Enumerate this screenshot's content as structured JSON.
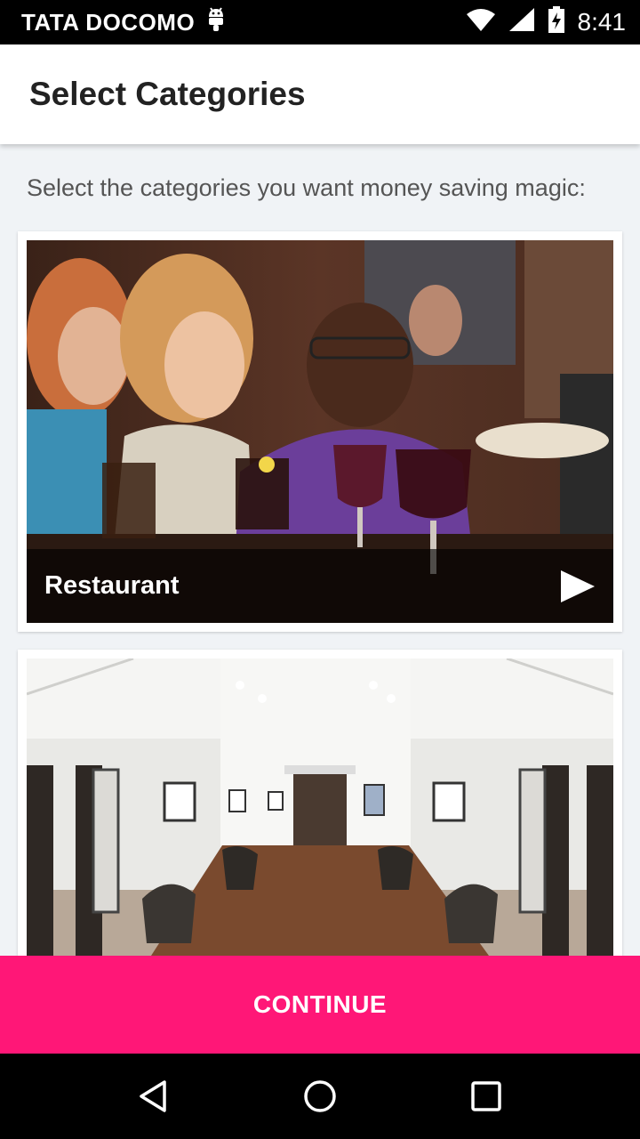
{
  "status_bar": {
    "carrier": "TATA DOCOMO",
    "time": "8:41"
  },
  "app_bar": {
    "title": "Select Categories"
  },
  "main": {
    "subtitle": "Select the categories you want money saving magic:",
    "categories": [
      {
        "label": "Restaurant",
        "image": "restaurant-photo"
      },
      {
        "image": "salon-photo"
      }
    ]
  },
  "continue_button": {
    "label": "CONTINUE"
  },
  "colors": {
    "accent": "#ff1777",
    "status_bar": "#000000",
    "background": "#f0f3f6"
  },
  "icons": {
    "android": "android-icon",
    "wifi": "wifi-icon",
    "signal": "signal-icon",
    "battery": "battery-charging-icon",
    "play": "play-icon",
    "back": "back-icon",
    "home": "home-icon",
    "recents": "recents-icon"
  }
}
